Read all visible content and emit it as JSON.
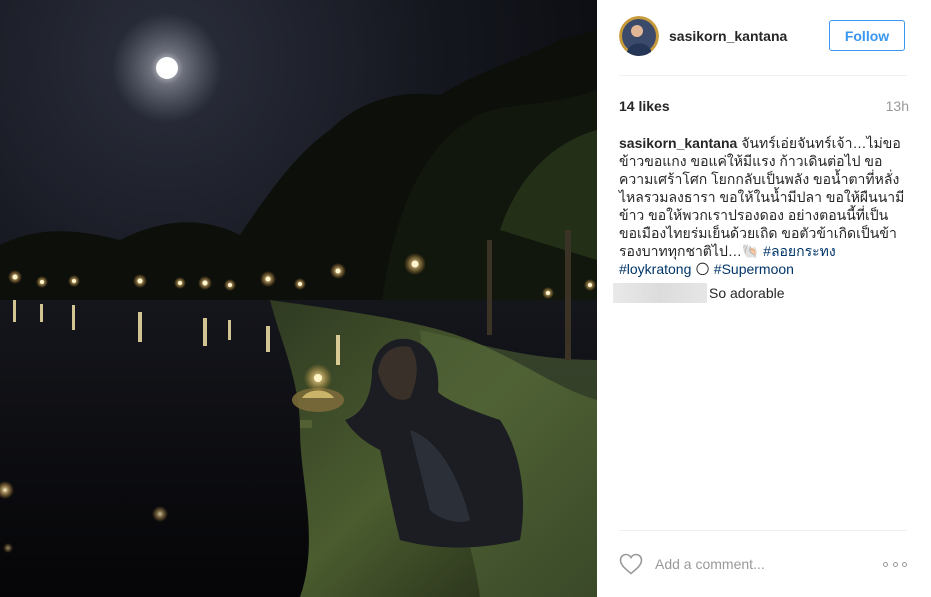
{
  "post": {
    "author": "sasikorn_kantana",
    "follow_label": "Follow",
    "likes": "14 likes",
    "time_ago": "13h",
    "caption": {
      "username": "sasikorn_kantana",
      "text": "จันทร์เอ่ยจันทร์เจ้า…ไม่ขอข้าวขอแกง ขอแค่ให้มีแรง ก้าวเดินต่อไป ขอความเศร้าโศก โยกกลับเป็นพลัง ขอน้ำตาที่หลั่งไหลรวมลงธารา ขอให้ในน้ำมีปลา ขอให้ผืนนามีข้าว ขอให้พวกเราปรองดอง อย่างตอนนี้ที่เป็น ขอเมืองไทยร่มเย็นด้วยเถิด ขอตัวข้าเกิดเป็นข้ารองบาททุกชาติไป…",
      "emoji": "🐚",
      "hashtag1": "#ลอยกระทง",
      "hashtag2": "#loykratong",
      "emoji2": "🌕",
      "hashtag3": "#Supermoon"
    },
    "comments": [
      {
        "text": "So adorable"
      }
    ],
    "add_comment_placeholder": "Add a comment..."
  },
  "icons": {
    "like": "heart-outline-icon",
    "options": "more-options-icon"
  },
  "colors": {
    "accent": "#3897f0",
    "hashtag": "#003569",
    "muted": "#999999",
    "divider": "#efefef"
  }
}
